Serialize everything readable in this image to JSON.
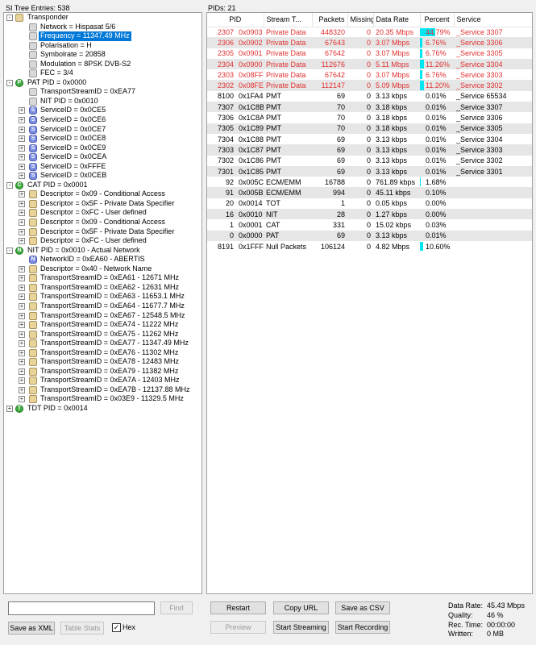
{
  "left_header": "SI Tree Entries: 538",
  "right_header": "PIDs: 21",
  "tree": [
    {
      "text": "Transponder",
      "level": 0,
      "expander": "-",
      "icon": "folder"
    },
    {
      "text": "Network = Hispasat 5/6",
      "level": 1,
      "expander": "",
      "icon": "plain"
    },
    {
      "text": "Frequency = 11347.49 MHz",
      "level": 1,
      "expander": "",
      "icon": "plain",
      "selected": true
    },
    {
      "text": "Polarisation = H",
      "level": 1,
      "expander": "",
      "icon": "plain"
    },
    {
      "text": "Symbolrate = 20858",
      "level": 1,
      "expander": "",
      "icon": "plain"
    },
    {
      "text": "Modulation = 8PSK DVB-S2",
      "level": 1,
      "expander": "",
      "icon": "plain"
    },
    {
      "text": "FEC = 3/4",
      "level": 1,
      "expander": "",
      "icon": "plain"
    },
    {
      "text": "PAT PID = 0x0000",
      "level": 0,
      "expander": "-",
      "icon": "green",
      "letter": "P"
    },
    {
      "text": "TransportStreamID = 0xEA77",
      "level": 1,
      "expander": "",
      "icon": "plain"
    },
    {
      "text": "NIT PID = 0x0010",
      "level": 1,
      "expander": "",
      "icon": "plain"
    },
    {
      "text": "ServiceID = 0x0CE5",
      "level": 1,
      "expander": "+",
      "icon": "sg",
      "letter": "S"
    },
    {
      "text": "ServiceID = 0x0CE6",
      "level": 1,
      "expander": "+",
      "icon": "sg",
      "letter": "S"
    },
    {
      "text": "ServiceID = 0x0CE7",
      "level": 1,
      "expander": "+",
      "icon": "sg",
      "letter": "S"
    },
    {
      "text": "ServiceID = 0x0CE8",
      "level": 1,
      "expander": "+",
      "icon": "sg",
      "letter": "S"
    },
    {
      "text": "ServiceID = 0x0CE9",
      "level": 1,
      "expander": "+",
      "icon": "sg",
      "letter": "S"
    },
    {
      "text": "ServiceID = 0x0CEA",
      "level": 1,
      "expander": "+",
      "icon": "sg",
      "letter": "S"
    },
    {
      "text": "ServiceID = 0xFFFE",
      "level": 1,
      "expander": "+",
      "icon": "sg",
      "letter": "S"
    },
    {
      "text": "ServiceID = 0x0CEB",
      "level": 1,
      "expander": "+",
      "icon": "sg",
      "letter": "S"
    },
    {
      "text": "CAT PID = 0x0001",
      "level": 0,
      "expander": "-",
      "icon": "green",
      "letter": "C"
    },
    {
      "text": "Descriptor = 0x09 - Conditional Access",
      "level": 1,
      "expander": "+",
      "icon": "folder"
    },
    {
      "text": "Descriptor = 0x5F - Private Data Specifier",
      "level": 1,
      "expander": "+",
      "icon": "folder"
    },
    {
      "text": "Descriptor = 0xFC - User defined",
      "level": 1,
      "expander": "+",
      "icon": "folder"
    },
    {
      "text": "Descriptor = 0x09 - Conditional Access",
      "level": 1,
      "expander": "+",
      "icon": "folder"
    },
    {
      "text": "Descriptor = 0x5F - Private Data Specifier",
      "level": 1,
      "expander": "+",
      "icon": "folder"
    },
    {
      "text": "Descriptor = 0xFC - User defined",
      "level": 1,
      "expander": "+",
      "icon": "folder"
    },
    {
      "text": "NIT PID = 0x0010 - Actual Network",
      "level": 0,
      "expander": "-",
      "icon": "green",
      "letter": "N"
    },
    {
      "text": "NetworkID = 0xEA60 - ABERTIS",
      "level": 1,
      "expander": "",
      "icon": "sg",
      "letter": "N"
    },
    {
      "text": "Descriptor = 0x40 - Network Name",
      "level": 1,
      "expander": "+",
      "icon": "folder"
    },
    {
      "text": "TransportStreamID = 0xEA61 - 12671 MHz",
      "level": 1,
      "expander": "+",
      "icon": "folder"
    },
    {
      "text": "TransportStreamID = 0xEA62 - 12631 MHz",
      "level": 1,
      "expander": "+",
      "icon": "folder"
    },
    {
      "text": "TransportStreamID = 0xEA63 - 11653.1 MHz",
      "level": 1,
      "expander": "+",
      "icon": "folder"
    },
    {
      "text": "TransportStreamID = 0xEA64 - 11677.7 MHz",
      "level": 1,
      "expander": "+",
      "icon": "folder"
    },
    {
      "text": "TransportStreamID = 0xEA67 - 12548.5 MHz",
      "level": 1,
      "expander": "+",
      "icon": "folder"
    },
    {
      "text": "TransportStreamID = 0xEA74 - 11222 MHz",
      "level": 1,
      "expander": "+",
      "icon": "folder"
    },
    {
      "text": "TransportStreamID = 0xEA75 - 11262 MHz",
      "level": 1,
      "expander": "+",
      "icon": "folder"
    },
    {
      "text": "TransportStreamID = 0xEA77 - 11347.49 MHz",
      "level": 1,
      "expander": "+",
      "icon": "folder"
    },
    {
      "text": "TransportStreamID = 0xEA76 - 11302 MHz",
      "level": 1,
      "expander": "+",
      "icon": "folder"
    },
    {
      "text": "TransportStreamID = 0xEA78 - 12483 MHz",
      "level": 1,
      "expander": "+",
      "icon": "folder"
    },
    {
      "text": "TransportStreamID = 0xEA79 - 11382 MHz",
      "level": 1,
      "expander": "+",
      "icon": "folder"
    },
    {
      "text": "TransportStreamID = 0xEA7A - 12403 MHz",
      "level": 1,
      "expander": "+",
      "icon": "folder"
    },
    {
      "text": "TransportStreamID = 0xEA7B - 12137.88 MHz",
      "level": 1,
      "expander": "+",
      "icon": "folder"
    },
    {
      "text": "TransportStreamID = 0x03E9 - 11329.5 MHz",
      "level": 1,
      "expander": "+",
      "icon": "folder"
    },
    {
      "text": "TDT PID = 0x0014",
      "level": 0,
      "expander": "+",
      "icon": "green",
      "letter": "T"
    }
  ],
  "columns": [
    "PID",
    "Stream T...",
    "Packets",
    "Missing",
    "Data Rate",
    "Percent",
    "Service"
  ],
  "rows": [
    {
      "pid": "2307",
      "hex": "0x0903",
      "type": "Private Data",
      "packets": "448320",
      "missing": "0",
      "rate": "20.35 Mbps",
      "percent": "44.79%",
      "pct": 44.79,
      "service": "_Service 3307",
      "red": true
    },
    {
      "pid": "2306",
      "hex": "0x0902",
      "type": "Private Data",
      "packets": "67643",
      "missing": "0",
      "rate": "3.07 Mbps",
      "percent": "6.76%",
      "pct": 6.76,
      "service": "_Service 3306",
      "red": true
    },
    {
      "pid": "2305",
      "hex": "0x0901",
      "type": "Private Data",
      "packets": "67642",
      "missing": "0",
      "rate": "3.07 Mbps",
      "percent": "6.76%",
      "pct": 6.76,
      "service": "_Service 3305",
      "red": true
    },
    {
      "pid": "2304",
      "hex": "0x0900",
      "type": "Private Data",
      "packets": "112676",
      "missing": "0",
      "rate": "5.11 Mbps",
      "percent": "11.26%",
      "pct": 11.26,
      "service": "_Service 3304",
      "red": true
    },
    {
      "pid": "2303",
      "hex": "0x08FF",
      "type": "Private Data",
      "packets": "67642",
      "missing": "0",
      "rate": "3.07 Mbps",
      "percent": "6.76%",
      "pct": 6.76,
      "service": "_Service 3303",
      "red": true
    },
    {
      "pid": "2302",
      "hex": "0x08FE",
      "type": "Private Data",
      "packets": "112147",
      "missing": "0",
      "rate": "5.09 Mbps",
      "percent": "11.20%",
      "pct": 11.2,
      "service": "_Service 3302",
      "red": true
    },
    {
      "pid": "8100",
      "hex": "0x1FA4",
      "type": "PMT",
      "packets": "69",
      "missing": "0",
      "rate": "3.13 kbps",
      "percent": "0.01%",
      "pct": 0.01,
      "service": "_Service 65534",
      "red": false
    },
    {
      "pid": "7307",
      "hex": "0x1C8B",
      "type": "PMT",
      "packets": "70",
      "missing": "0",
      "rate": "3.18 kbps",
      "percent": "0.01%",
      "pct": 0.01,
      "service": "_Service 3307",
      "red": false
    },
    {
      "pid": "7306",
      "hex": "0x1C8A",
      "type": "PMT",
      "packets": "70",
      "missing": "0",
      "rate": "3.18 kbps",
      "percent": "0.01%",
      "pct": 0.01,
      "service": "_Service 3306",
      "red": false
    },
    {
      "pid": "7305",
      "hex": "0x1C89",
      "type": "PMT",
      "packets": "70",
      "missing": "0",
      "rate": "3.18 kbps",
      "percent": "0.01%",
      "pct": 0.01,
      "service": "_Service 3305",
      "red": false
    },
    {
      "pid": "7304",
      "hex": "0x1C88",
      "type": "PMT",
      "packets": "69",
      "missing": "0",
      "rate": "3.13 kbps",
      "percent": "0.01%",
      "pct": 0.01,
      "service": "_Service 3304",
      "red": false
    },
    {
      "pid": "7303",
      "hex": "0x1C87",
      "type": "PMT",
      "packets": "69",
      "missing": "0",
      "rate": "3.13 kbps",
      "percent": "0.01%",
      "pct": 0.01,
      "service": "_Service 3303",
      "red": false
    },
    {
      "pid": "7302",
      "hex": "0x1C86",
      "type": "PMT",
      "packets": "69",
      "missing": "0",
      "rate": "3.13 kbps",
      "percent": "0.01%",
      "pct": 0.01,
      "service": "_Service 3302",
      "red": false
    },
    {
      "pid": "7301",
      "hex": "0x1C85",
      "type": "PMT",
      "packets": "69",
      "missing": "0",
      "rate": "3.13 kbps",
      "percent": "0.01%",
      "pct": 0.01,
      "service": "_Service 3301",
      "red": false
    },
    {
      "pid": "92",
      "hex": "0x005C",
      "type": "ECM/EMM",
      "packets": "16788",
      "missing": "0",
      "rate": "761.89 kbps",
      "percent": "1.68%",
      "pct": 1.68,
      "service": "",
      "red": false
    },
    {
      "pid": "91",
      "hex": "0x005B",
      "type": "ECM/EMM",
      "packets": "994",
      "missing": "0",
      "rate": "45.11 kbps",
      "percent": "0.10%",
      "pct": 0.1,
      "service": "",
      "red": false
    },
    {
      "pid": "20",
      "hex": "0x0014",
      "type": "TOT",
      "packets": "1",
      "missing": "0",
      "rate": "0.05 kbps",
      "percent": "0.00%",
      "pct": 0,
      "service": "",
      "red": false
    },
    {
      "pid": "16",
      "hex": "0x0010",
      "type": "NIT",
      "packets": "28",
      "missing": "0",
      "rate": "1.27 kbps",
      "percent": "0.00%",
      "pct": 0,
      "service": "",
      "red": false
    },
    {
      "pid": "1",
      "hex": "0x0001",
      "type": "CAT",
      "packets": "331",
      "missing": "0",
      "rate": "15.02 kbps",
      "percent": "0.03%",
      "pct": 0.03,
      "service": "",
      "red": false
    },
    {
      "pid": "0",
      "hex": "0x0000",
      "type": "PAT",
      "packets": "69",
      "missing": "0",
      "rate": "3.13 kbps",
      "percent": "0.01%",
      "pct": 0.01,
      "service": "",
      "red": false
    },
    {
      "pid": "8191",
      "hex": "0x1FFF",
      "type": "Null Packets",
      "packets": "106124",
      "missing": "0",
      "rate": "4.82 Mbps",
      "percent": "10.60%",
      "pct": 10.6,
      "service": "",
      "red": false
    }
  ],
  "search": {
    "value": "",
    "find_label": "Find"
  },
  "left_buttons": {
    "save_xml": "Save as XML",
    "table_stats": "Table Stats",
    "hex_label": "Hex",
    "hex_checked": "✓"
  },
  "buttons": {
    "restart": "Restart",
    "copy_url": "Copy URL",
    "save_csv": "Save as CSV",
    "preview": "Preview",
    "start_streaming": "Start Streaming",
    "start_recording": "Start Recording"
  },
  "stats": {
    "data_rate_label": "Data Rate:",
    "data_rate_value": "45.43 Mbps",
    "quality_label": "Quality:",
    "quality_value": "46 %",
    "rec_time_label": "Rec. Time:",
    "rec_time_value": "00:00:00",
    "written_label": "Written:",
    "written_value": "0 MB"
  },
  "colors": {
    "selection": "#0078d7",
    "percent_bar": "#00e6f0",
    "highlight_text": "#e03030"
  }
}
